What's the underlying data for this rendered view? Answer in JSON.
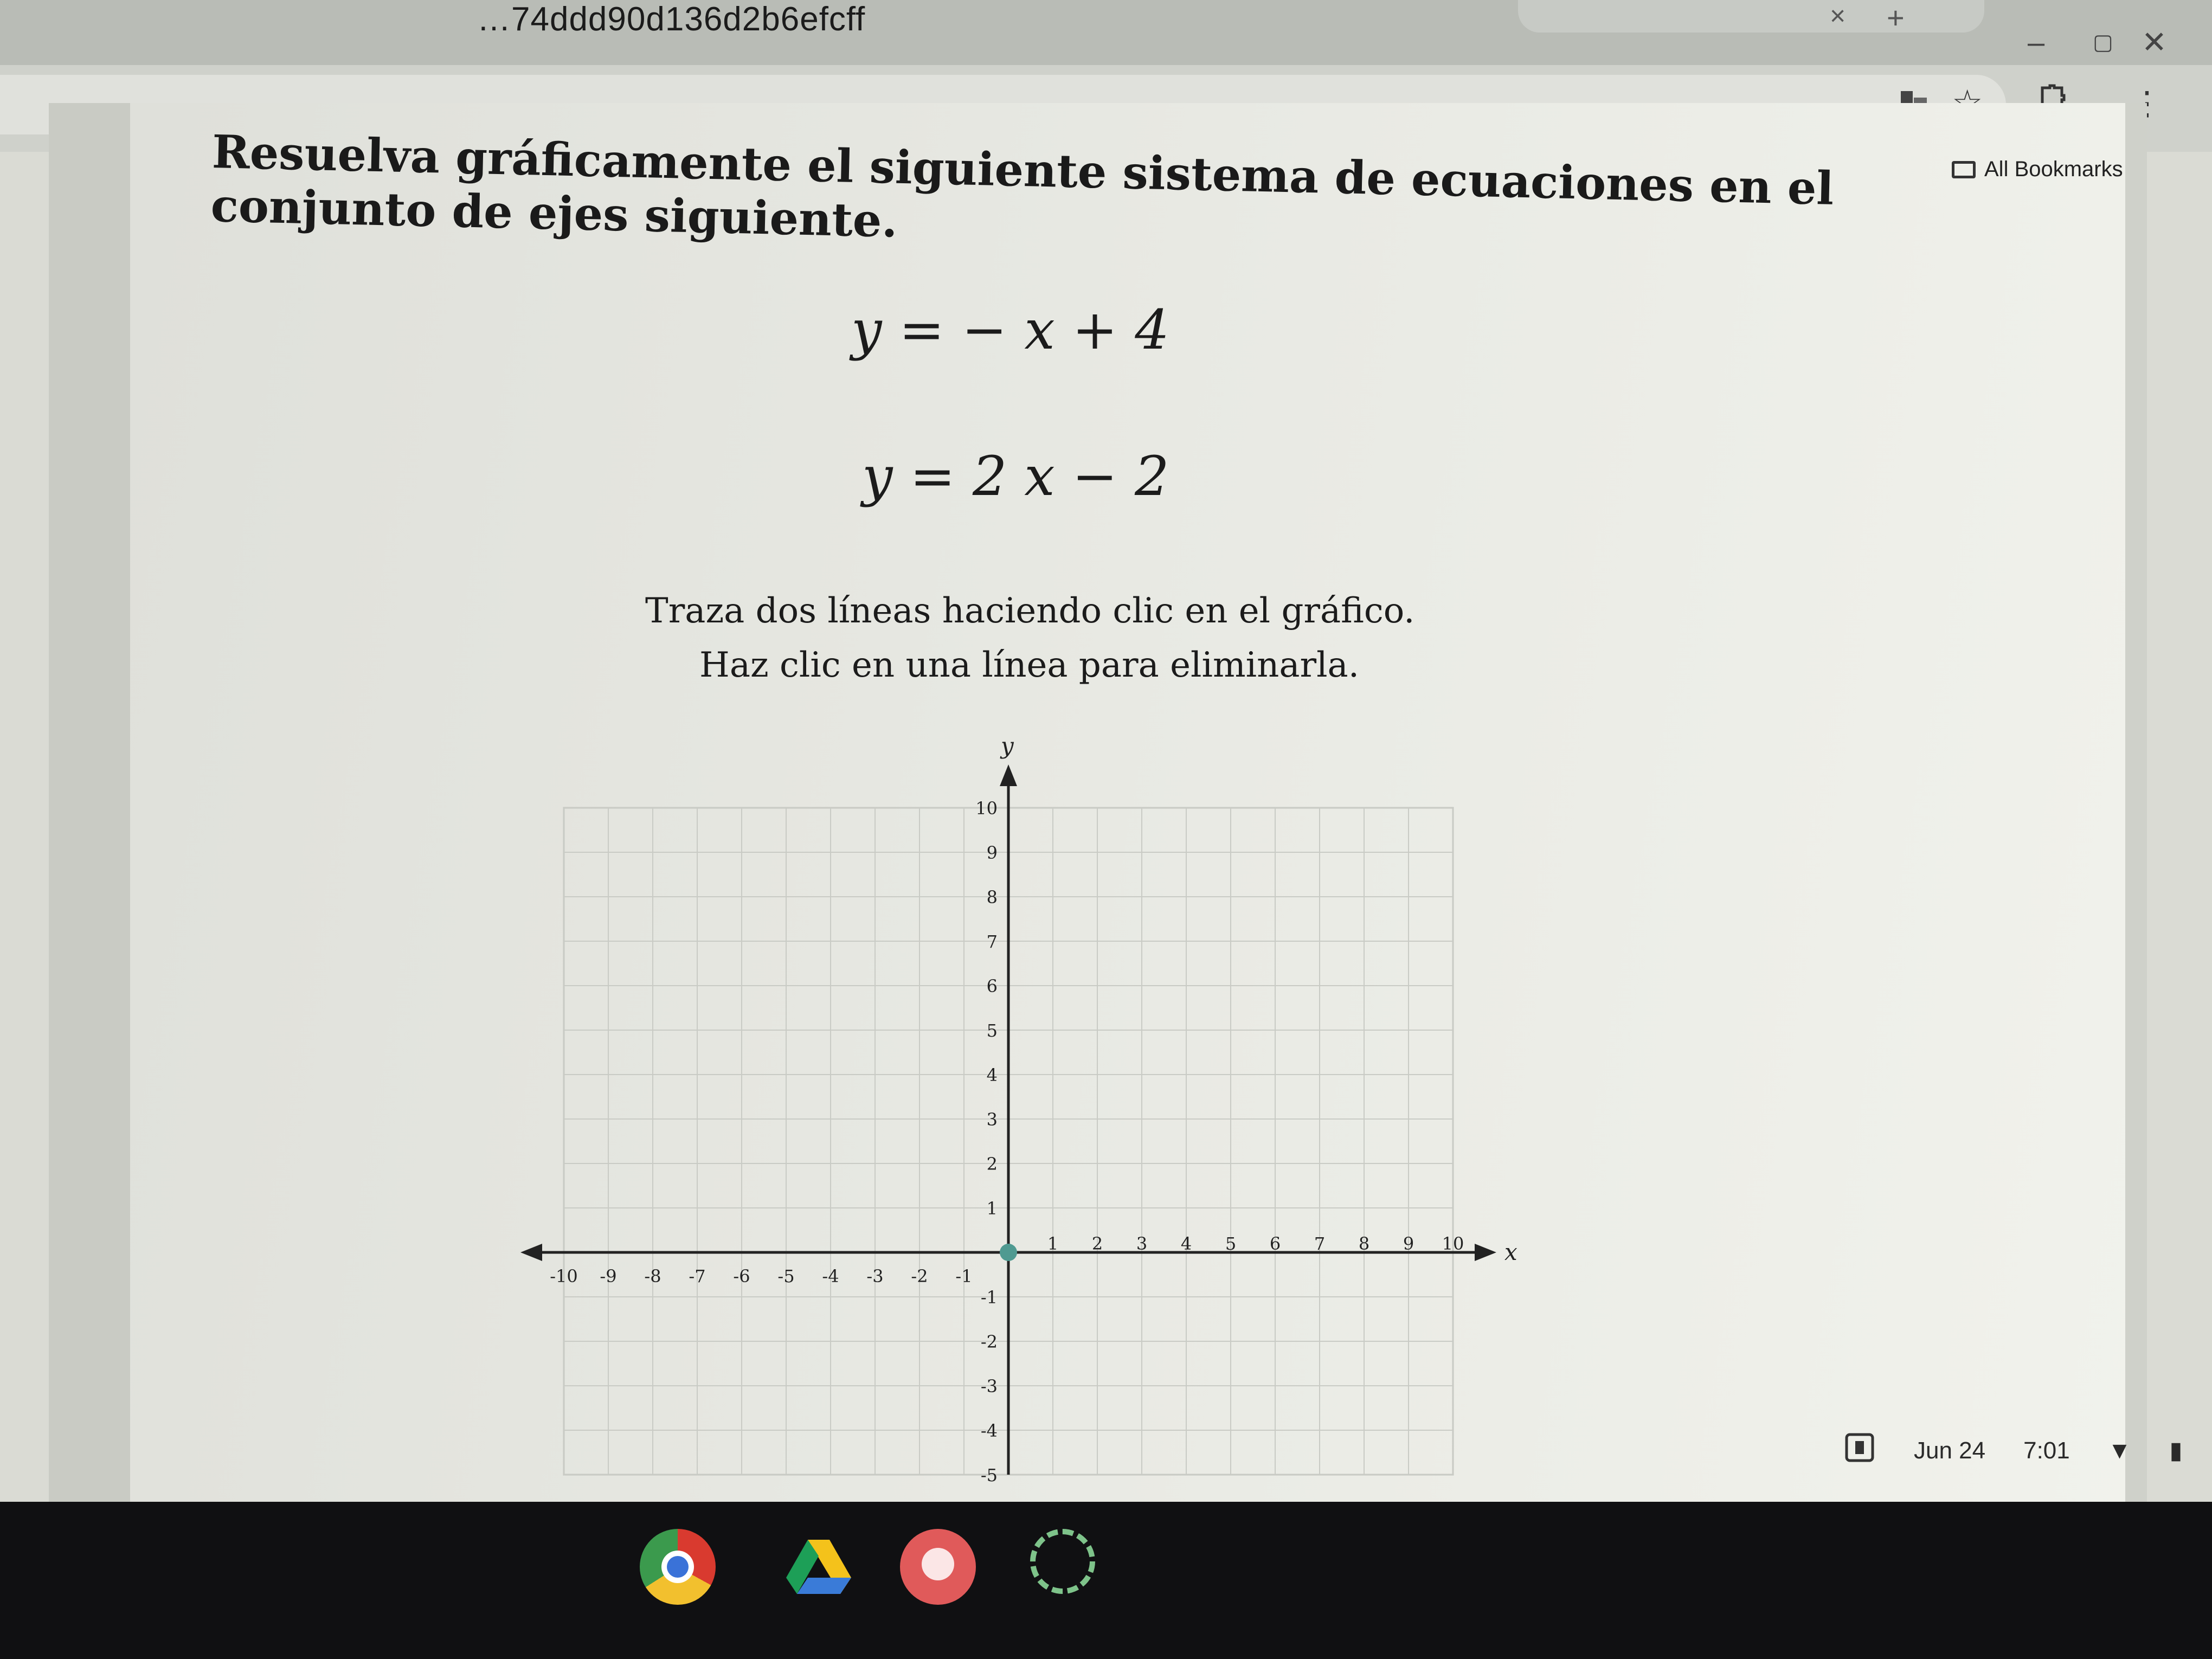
{
  "browser": {
    "url_fragment": "…74ddd90d136d2b6efcff",
    "tab_title": "",
    "tab_close": "×",
    "new_tab": "+",
    "window_controls": [
      "–",
      "▢",
      "✕"
    ],
    "toolbar_icons": [
      "extension-icon",
      "star-icon",
      "puzzle-icon",
      "menu-icon"
    ],
    "bookmarks_label": "All Bookmarks"
  },
  "question": {
    "title": "Resuelva gráficamente el siguiente sistema de ecuaciones en el conjunto de ejes siguiente.",
    "equation_1": "y = − x + 4",
    "equation_2": "y = 2 x − 2",
    "instruction_1": "Traza dos líneas haciendo clic en el gráfico.",
    "instruction_2": "Haz clic en una línea para eliminarla."
  },
  "graph": {
    "x_axis_label": "x",
    "y_axis_label": "y",
    "x_range": [
      -10,
      10
    ],
    "y_range_visible": [
      -5,
      10
    ],
    "grid": true,
    "x_ticks": [
      -10,
      -9,
      -8,
      -7,
      -6,
      -5,
      -4,
      -3,
      -2,
      -1,
      1,
      2,
      3,
      4,
      5,
      6,
      7,
      8,
      9,
      10
    ],
    "y_ticks": [
      10,
      9,
      8,
      7,
      6,
      5,
      4,
      3,
      2,
      1,
      -1,
      -2,
      -3,
      -4,
      -5
    ],
    "origin_point_color": "#4f9a91"
  },
  "system_tray": {
    "date": "Jun 24",
    "time": "7:01"
  },
  "taskbar_apps": [
    "chrome-icon",
    "drive-icon",
    "app-red-icon",
    "app-loading-icon"
  ]
}
